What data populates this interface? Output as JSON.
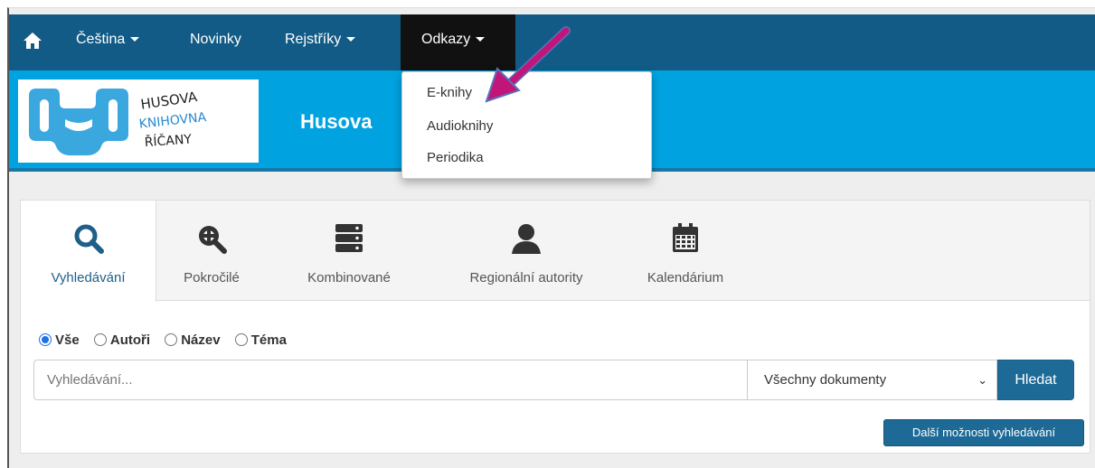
{
  "navbar": {
    "home_icon": "home-icon",
    "items": [
      {
        "label": "Čeština"
      },
      {
        "label": "Novinky"
      },
      {
        "label": "Rejstříky"
      },
      {
        "label": "Odkazy"
      }
    ]
  },
  "banner": {
    "logo_text": [
      "HUSOVA",
      "KNIHOVNA",
      "ŘÍČANY"
    ],
    "title": "Husova"
  },
  "dropdown": {
    "items": [
      {
        "label": "E-knihy"
      },
      {
        "label": "Audioknihy"
      },
      {
        "label": "Periodika"
      }
    ]
  },
  "tabs": [
    {
      "label": "Vyhledávání",
      "icon": "search-icon"
    },
    {
      "label": "Pokročilé",
      "icon": "zoom-in-icon"
    },
    {
      "label": "Kombinované",
      "icon": "server-stack-icon"
    },
    {
      "label": "Regionální autority",
      "icon": "user-icon"
    },
    {
      "label": "Kalendárium",
      "icon": "calendar-icon"
    }
  ],
  "search": {
    "radios": [
      {
        "label": "Vše",
        "checked": true
      },
      {
        "label": "Autoři",
        "checked": false
      },
      {
        "label": "Název",
        "checked": false
      },
      {
        "label": "Téma",
        "checked": false
      }
    ],
    "placeholder": "Vyhledávání...",
    "select_value": "Všechny dokumenty",
    "submit_label": "Hledat",
    "more_label": "Další možnosti vyhledávání"
  },
  "colors": {
    "navbar": "#125b86",
    "banner": "#00a3e0",
    "active_nav": "#111111",
    "button": "#1e6a96",
    "arrow": "#c2157a"
  }
}
